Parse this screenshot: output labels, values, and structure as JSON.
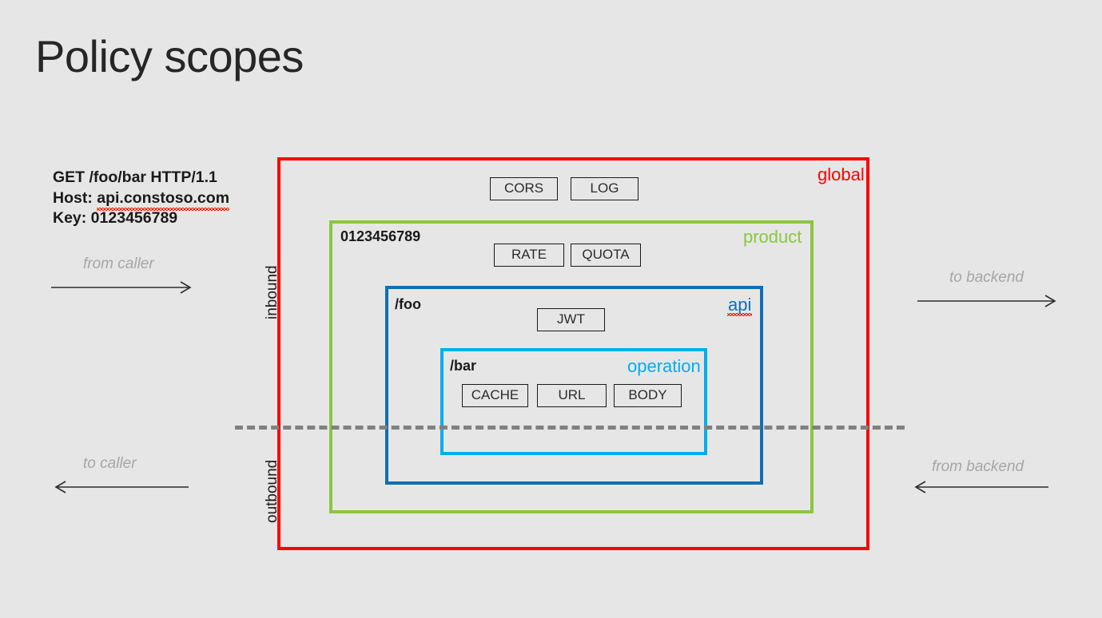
{
  "page": {
    "title": "Policy scopes",
    "background_color": "#e6e6e6"
  },
  "request": {
    "line1": "GET /foo/bar HTTP/1.1",
    "line2_prefix": "Host: ",
    "line2_host": "api.constoso.com",
    "line3": "Key: 0123456789"
  },
  "pipeline": {
    "inbound_label": "inbound",
    "outbound_label": "outbound"
  },
  "flows": {
    "from_caller": "from caller",
    "to_caller": "to caller",
    "to_backend": "to backend",
    "from_backend": "from backend"
  },
  "scopes": [
    {
      "id": "global",
      "label": "global",
      "color": "#ff0000",
      "name": "",
      "policies": [
        "CORS",
        "LOG"
      ]
    },
    {
      "id": "product",
      "label": "product",
      "color": "#8cc63f",
      "name": "0123456789",
      "policies": [
        "RATE",
        "QUOTA"
      ]
    },
    {
      "id": "api",
      "label": "api",
      "color": "#0f6fb5",
      "name": "/foo",
      "policies": [
        "JWT"
      ]
    },
    {
      "id": "operation",
      "label": "operation",
      "color": "#00aeef",
      "name": "/bar",
      "policies": [
        "CACHE",
        "URL",
        "BODY"
      ]
    }
  ],
  "policies": {
    "cors": "CORS",
    "log": "LOG",
    "rate": "RATE",
    "quota": "QUOTA",
    "jwt": "JWT",
    "cache": "CACHE",
    "url": "URL",
    "body": "BODY"
  }
}
